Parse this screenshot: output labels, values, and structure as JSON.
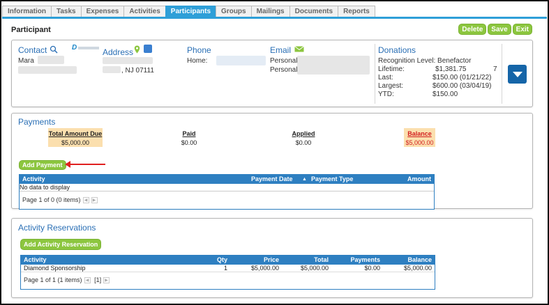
{
  "tabs": [
    "Information",
    "Tasks",
    "Expenses",
    "Activities",
    "Participants",
    "Groups",
    "Mailings",
    "Documents",
    "Reports"
  ],
  "active_tab": "Participants",
  "page_title": "Participant",
  "actions": {
    "delete": "Delete",
    "save": "Save",
    "exit": "Exit"
  },
  "contact": {
    "heading": "Contact",
    "first_name": "Mara",
    "logo_text": "D"
  },
  "address": {
    "heading": "Address",
    "city_line": ", NJ 07111"
  },
  "phone": {
    "heading": "Phone",
    "home_label": "Home:"
  },
  "email": {
    "heading": "Email",
    "personal_label_1": "Personal:",
    "personal_label_2": "Personal:"
  },
  "donations": {
    "heading": "Donations",
    "recognition": "Recognition Level: Benefactor",
    "lifetime_label": "Lifetime:",
    "lifetime_value": "$1,381.75",
    "lifetime_count": "7",
    "last_label": "Last:",
    "last_value": "$150.00 (01/21/22)",
    "largest_label": "Largest:",
    "largest_value": "$600.00 (03/04/19)",
    "ytd_label": "YTD:",
    "ytd_value": "$150.00"
  },
  "payments": {
    "heading": "Payments",
    "summary": {
      "total_due_label": "Total Amount Due",
      "total_due_value": "$5,000.00",
      "paid_label": "Paid",
      "paid_value": "$0.00",
      "applied_label": "Applied",
      "applied_value": "$0.00",
      "balance_label": "Balance",
      "balance_value": "$5,000.00"
    },
    "add_button": "Add Payment",
    "columns": {
      "activity": "Activity",
      "date": "Payment Date",
      "type": "Payment Type",
      "amount": "Amount"
    },
    "empty": "No data to display",
    "pager": "Page 1 of 0 (0 items)"
  },
  "reservations": {
    "heading": "Activity Reservations",
    "add_button": "Add Activity Reservation",
    "columns": {
      "activity": "Activity",
      "qty": "Qty",
      "price": "Price",
      "total": "Total",
      "payments": "Payments",
      "balance": "Balance"
    },
    "rows": [
      {
        "activity": "Diamond Sponsorship",
        "qty": "1",
        "price": "$5,000.00",
        "total": "$5,000.00",
        "payments": "$0.00",
        "balance": "$5,000.00"
      }
    ],
    "pager": "Page 1 of 1 (1 items)",
    "page_current": "[1]"
  },
  "colors": {
    "accent": "#2e9fd8",
    "grid_header": "#2e7fc1",
    "green_button": "#8cc63f",
    "balance_red": "#d32020",
    "arrow": "#e02020"
  }
}
